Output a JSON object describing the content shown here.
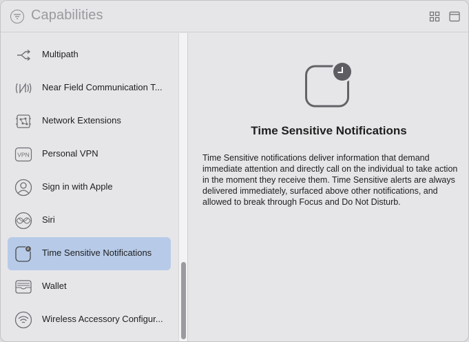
{
  "header": {
    "title": "Capabilities",
    "filter_icon": "filter-circle-icon",
    "grid_icon": "grid-view-icon",
    "panel_icon": "panel-toggle-icon"
  },
  "sidebar": {
    "items": [
      {
        "label": "Multipath",
        "icon": "multipath-icon"
      },
      {
        "label": "Near Field Communication T...",
        "icon": "nfc-icon"
      },
      {
        "label": "Network Extensions",
        "icon": "network-extensions-icon"
      },
      {
        "label": "Personal VPN",
        "icon": "vpn-icon",
        "icon_text": "VPN"
      },
      {
        "label": "Sign in with Apple",
        "icon": "person-circle-icon"
      },
      {
        "label": "Siri",
        "icon": "siri-icon"
      },
      {
        "label": "Time Sensitive Notifications",
        "icon": "time-sensitive-icon",
        "selected": true
      },
      {
        "label": "Wallet",
        "icon": "wallet-icon"
      },
      {
        "label": "Wireless Accessory Configur...",
        "icon": "wireless-icon"
      }
    ]
  },
  "detail": {
    "title": "Time Sensitive Notifications",
    "description": "Time Sensitive notifications deliver information that demand immediate attention and directly call on the individual to take action in the moment they receive them. Time Sensitive alerts are always delivered immediately, surfaced above other notifications, and allowed to break through Focus and Do Not Disturb.",
    "icon": "time-sensitive-icon"
  },
  "colors": {
    "selection": "#b7cbe8",
    "icon_gray": "#6e6e72",
    "background": "#e6e6e9"
  }
}
